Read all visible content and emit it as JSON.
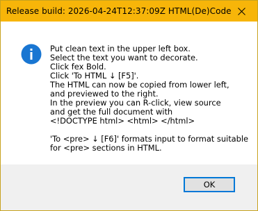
{
  "window": {
    "title": "Release build: 2026-04-24T12:37:09Z  HTML(De)Code",
    "close_icon": "close-icon",
    "titlebar_color": "#f7b509"
  },
  "dialog": {
    "icon": "info-icon",
    "icon_color": "#1976d2",
    "message_lines": [
      "Put clean text in the upper left box.",
      "Select the text you want to decorate.",
      "Click fex Bold.",
      "Click 'To HTML ↓ [F5]'.",
      "The HTML can now be copied from lower left,",
      "and previewed to the right.",
      "In the preview you can R-click, view source",
      "and get the full document with",
      "<!DOCTYPE html> <html> </html>",
      "",
      "'To <pre> ↓ [F6]' formats input to format suitable",
      "for <pre> sections in HTML."
    ]
  },
  "buttons": {
    "ok_label": "OK"
  }
}
